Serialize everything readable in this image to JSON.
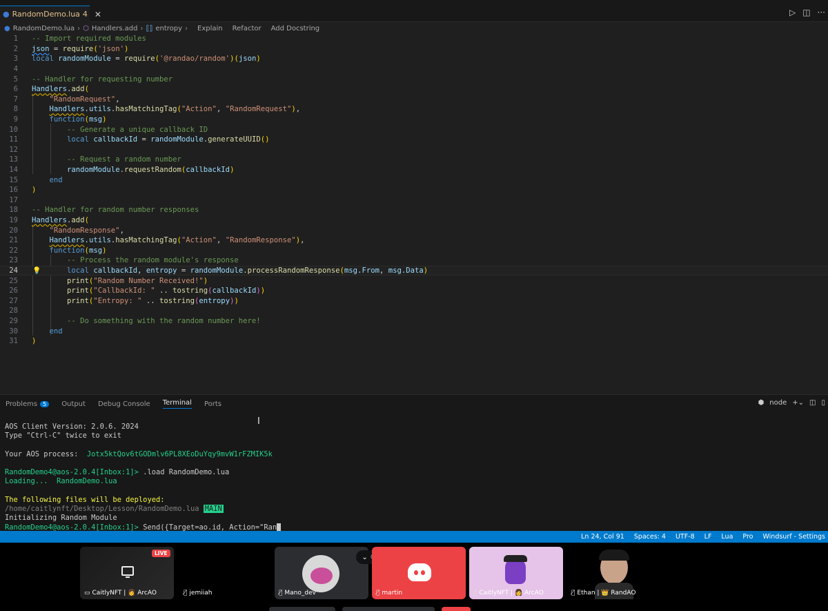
{
  "tab": {
    "file_name": "RandomDemo.lua",
    "problem_count": "4"
  },
  "breadcrumb": {
    "file": "RandomDemo.lua",
    "symbol1": "Handlers.add",
    "symbol2": "entropy",
    "actions": [
      "Explain",
      "Refactor",
      "Add Docstring"
    ]
  },
  "editor": {
    "current_line": 24,
    "lines": [
      "-- Import required modules",
      "json = require('json')",
      "local randomModule = require('@randao/random')(json)",
      "",
      "-- Handler for requesting number",
      "Handlers.add(",
      "    \"RandomRequest\",",
      "    Handlers.utils.hasMatchingTag(\"Action\", \"RandomRequest\"),",
      "    function(msg)",
      "        -- Generate a unique callback ID",
      "        local callbackId = randomModule.generateUUID()",
      "",
      "        -- Request a random number",
      "        randomModule.requestRandom(callbackId)",
      "    end",
      ")",
      "",
      "-- Handler for random number responses",
      "Handlers.add(",
      "    \"RandomResponse\",",
      "    Handlers.utils.hasMatchingTag(\"Action\", \"RandomResponse\"),",
      "    function(msg)",
      "        -- Process the random module's response",
      "        local callbackId, entropy = randomModule.processRandomResponse(msg.From, msg.Data)",
      "        print(\"Random Number Received!\")",
      "        print(\"CallbackId: \" .. tostring(callbackId))",
      "        print(\"Entropy: \" .. tostring(entropy))",
      "",
      "        -- Do something with the random number here!",
      "    end",
      ")"
    ]
  },
  "panel": {
    "tabs": [
      "Problems",
      "Output",
      "Debug Console",
      "Terminal",
      "Ports"
    ],
    "problems_badge": "5",
    "active_tab": "Terminal",
    "shell": "node"
  },
  "terminal": {
    "version_line": "AOS Client Version: 2.0.6. 2024",
    "exit_hint": "Type \"Ctrl-C\" twice to exit",
    "process_label": "Your AOS process:",
    "process_id": "Jotx5ktQov6tGODmlv6PL8XEoDuYqy9mvW1rFZMIK5k",
    "prompt": "RandomDemo4@aos-2.0.4[Inbox:1]>",
    "load_cmd": " .load RandomDemo.lua",
    "loading_label": "Loading...",
    "loading_file": "RandomDemo.lua",
    "deploy_heading": "The following files will be deployed:",
    "deploy_path": "/home/caitlynft/Desktop/Lesson/RandomDemo.lua",
    "deploy_badge": "MAIN",
    "init_line": "Initializing Random Module",
    "send_cmd": " Send({Target=ao.id, Action=\"Ran"
  },
  "statusbar": {
    "position": "Ln 24, Col 91",
    "spaces": "Spaces: 4",
    "encoding": "UTF-8",
    "eol": "LF",
    "language": "Lua",
    "pro": "Pro",
    "settings": "Windsurf - Settings"
  },
  "call": {
    "live_badge": "LIVE",
    "participants": [
      {
        "name": "CaitlyNFT | 👩 ArcAO",
        "muted": false,
        "kind": "screen"
      },
      {
        "name": "jemiiah",
        "muted": true,
        "kind": "empty"
      },
      {
        "name": "Mano_dev",
        "muted": true,
        "kind": "avatar"
      },
      {
        "name": "martin",
        "muted": true,
        "kind": "discord"
      },
      {
        "name": "CaitlyNFT | 👩 ArcAO",
        "muted": true,
        "kind": "avatar"
      },
      {
        "name": "Ethan | 👑 RandAO",
        "muted": true,
        "kind": "video"
      }
    ],
    "colors": {
      "discord_red": "#ed4245",
      "pink_tile": "#e6c3e8"
    }
  }
}
